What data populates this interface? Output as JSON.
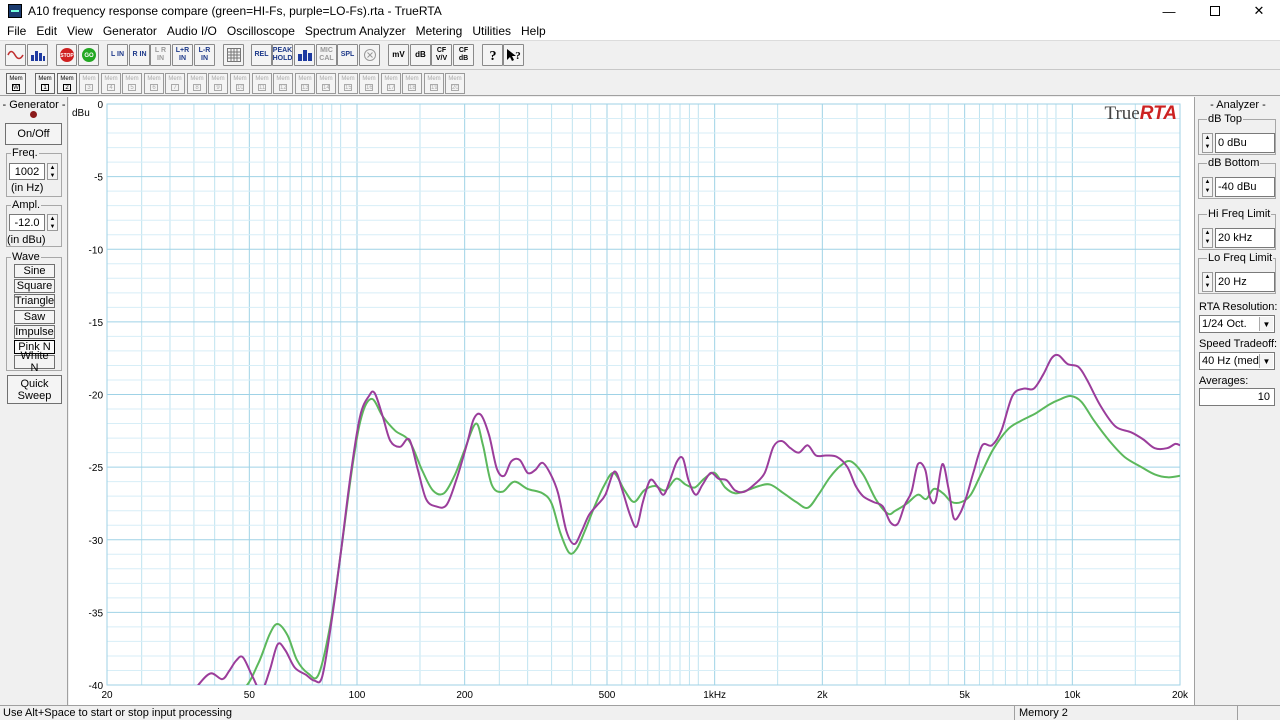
{
  "window": {
    "title": "A10 frequency response compare (green=HI-Fs, purple=LO-Fs).rta - TrueRTA",
    "minimize": "—",
    "close": "✕"
  },
  "menu": [
    "File",
    "Edit",
    "View",
    "Generator",
    "Audio I/O",
    "Oscilloscope",
    "Spectrum Analyzer",
    "Metering",
    "Utilities",
    "Help"
  ],
  "toolbar": {
    "stop_label": "STOP",
    "go_label": "GO",
    "l_in": "L IN",
    "r_in": "R IN",
    "lr_in_disabled": "L R IN",
    "lpr_in": "L+R IN",
    "lmr_in": "L-R IN",
    "rel": "REL",
    "peak_hold": "PEAK HOLD",
    "mic_cal": "MIC CAL",
    "spl": "SPL",
    "mv": "mV",
    "db": "dB",
    "cf_vv": "CF V/V",
    "cf_db": "CF dB"
  },
  "memory_buttons": [
    {
      "top": "Mem",
      "bottom": "W"
    },
    {
      "top": "Mem",
      "bottom": "1"
    },
    {
      "top": "Mem",
      "bottom": "2"
    },
    {
      "top": "Mem",
      "bottom": "3"
    },
    {
      "top": "Mem",
      "bottom": "4"
    },
    {
      "top": "Mem",
      "bottom": "5"
    },
    {
      "top": "Mem",
      "bottom": "6"
    },
    {
      "top": "Mem",
      "bottom": "7"
    },
    {
      "top": "Mem",
      "bottom": "8"
    },
    {
      "top": "Mem",
      "bottom": "9"
    },
    {
      "top": "Mem",
      "bottom": "10"
    },
    {
      "top": "Mem",
      "bottom": "11"
    },
    {
      "top": "Mem",
      "bottom": "12"
    },
    {
      "top": "Mem",
      "bottom": "13"
    },
    {
      "top": "Mem",
      "bottom": "14"
    },
    {
      "top": "Mem",
      "bottom": "15"
    },
    {
      "top": "Mem",
      "bottom": "16"
    },
    {
      "top": "Mem",
      "bottom": "17"
    },
    {
      "top": "Mem",
      "bottom": "18"
    },
    {
      "top": "Mem",
      "bottom": "19"
    },
    {
      "top": "Mem",
      "bottom": "20"
    },
    {
      "top": "Mem",
      "bottom": "21"
    }
  ],
  "generator": {
    "title": "- Generator -",
    "on_off": "On/Off",
    "freq_label": "Freq.",
    "freq_value": "1002",
    "freq_unit": "(in Hz)",
    "ampl_label": "Ampl.",
    "ampl_value": "-12.0",
    "ampl_unit": "(in dBu)",
    "wave_label": "Wave",
    "waves": [
      "Sine",
      "Square",
      "Triangle",
      "Saw",
      "Impulse",
      "Pink N",
      "White N"
    ],
    "quick_sweep": "Quick Sweep"
  },
  "analyzer": {
    "title": "- Analyzer -",
    "db_top_label": "dB Top",
    "db_top_value": "0 dBu",
    "db_bottom_label": "dB Bottom",
    "db_bottom_value": "-40 dBu",
    "hi_freq_label": "Hi Freq Limit",
    "hi_freq_value": "20 kHz",
    "lo_freq_label": "Lo Freq Limit",
    "lo_freq_value": "20 Hz",
    "resolution_label": "RTA Resolution:",
    "resolution_value": "1/24 Oct.",
    "speed_label": "Speed Tradeoff:",
    "speed_value": "40 Hz (med)",
    "averages_label": "Averages:",
    "averages_value": "10"
  },
  "status": {
    "hint": "Use Alt+Space to start or stop input processing",
    "memory": "Memory 2"
  },
  "colors": {
    "green_trace": "#5cb85c",
    "purple_trace": "#9b3d9b",
    "grid": "#bfe3f0",
    "logo_red": "#cc2222"
  },
  "chart_data": {
    "type": "line",
    "logo": "True",
    "logo_accent": "RTA",
    "ylabel": "dBu",
    "ylim": [
      -40,
      0
    ],
    "xlim": [
      20,
      20000
    ],
    "x_scale": "log",
    "y_ticks": [
      0,
      -5,
      -10,
      -15,
      -20,
      -25,
      -30,
      -35,
      -40
    ],
    "y_tick_labels": [
      "0",
      "-5",
      "-10",
      "-15",
      "-20",
      "-25",
      "-30",
      "-35",
      "-40"
    ],
    "x_ticks": [
      20,
      50,
      100,
      200,
      500,
      1000,
      2000,
      5000,
      10000,
      20000
    ],
    "x_tick_labels": [
      "20",
      "50",
      "100",
      "200",
      "500",
      "1kHz",
      "2k",
      "5k",
      "10k",
      "20k"
    ],
    "grid": true,
    "series": [
      {
        "color": "#5cb85c",
        "points": [
          [
            40,
            -41
          ],
          [
            48,
            -40.3
          ],
          [
            53,
            -38.5
          ],
          [
            57,
            -36.5
          ],
          [
            60,
            -35.8
          ],
          [
            64,
            -36.6
          ],
          [
            68,
            -38.3
          ],
          [
            73,
            -39.2
          ],
          [
            78,
            -39.3
          ],
          [
            84,
            -36
          ],
          [
            90,
            -31
          ],
          [
            97,
            -25
          ],
          [
            103,
            -21.5
          ],
          [
            110,
            -20.3
          ],
          [
            118,
            -21.5
          ],
          [
            128,
            -22.5
          ],
          [
            140,
            -23.2
          ],
          [
            152,
            -25.2
          ],
          [
            163,
            -26.6
          ],
          [
            175,
            -26.8
          ],
          [
            188,
            -25.5
          ],
          [
            200,
            -23.8
          ],
          [
            215,
            -22
          ],
          [
            225,
            -23.5
          ],
          [
            238,
            -26.2
          ],
          [
            255,
            -26.7
          ],
          [
            275,
            -26
          ],
          [
            300,
            -26.5
          ],
          [
            330,
            -26.8
          ],
          [
            350,
            -27.5
          ],
          [
            370,
            -29.5
          ],
          [
            392,
            -30.9
          ],
          [
            412,
            -30.6
          ],
          [
            435,
            -29.3
          ],
          [
            460,
            -27.8
          ],
          [
            490,
            -26.3
          ],
          [
            522,
            -25.4
          ],
          [
            560,
            -26.6
          ],
          [
            595,
            -27.4
          ],
          [
            635,
            -26.6
          ],
          [
            680,
            -26.3
          ],
          [
            728,
            -26.6
          ],
          [
            780,
            -25.8
          ],
          [
            830,
            -26.2
          ],
          [
            880,
            -26.4
          ],
          [
            935,
            -25.8
          ],
          [
            1000,
            -25.4
          ],
          [
            1070,
            -26.4
          ],
          [
            1140,
            -26.8
          ],
          [
            1230,
            -26.6
          ],
          [
            1330,
            -26.3
          ],
          [
            1430,
            -26.2
          ],
          [
            1560,
            -26.8
          ],
          [
            1690,
            -27.4
          ],
          [
            1820,
            -27.8
          ],
          [
            1950,
            -26.9
          ],
          [
            2100,
            -25.7
          ],
          [
            2250,
            -24.9
          ],
          [
            2400,
            -24.6
          ],
          [
            2600,
            -25.5
          ],
          [
            2820,
            -27.2
          ],
          [
            3050,
            -28.2
          ],
          [
            3200,
            -28
          ],
          [
            3450,
            -27.5
          ],
          [
            3700,
            -26.9
          ],
          [
            3900,
            -27.2
          ],
          [
            4100,
            -26.5
          ],
          [
            4350,
            -26.8
          ],
          [
            4600,
            -27.4
          ],
          [
            4900,
            -27.4
          ],
          [
            5200,
            -26.9
          ],
          [
            5550,
            -25.5
          ],
          [
            6000,
            -23.8
          ],
          [
            6600,
            -22.4
          ],
          [
            7200,
            -21.8
          ],
          [
            7900,
            -21.3
          ],
          [
            8600,
            -20.7
          ],
          [
            9300,
            -20.3
          ],
          [
            9900,
            -20.1
          ],
          [
            10600,
            -20.5
          ],
          [
            11500,
            -21.8
          ],
          [
            12700,
            -23.2
          ],
          [
            14000,
            -24.3
          ],
          [
            15600,
            -25
          ],
          [
            17000,
            -25.5
          ],
          [
            18500,
            -25.7
          ],
          [
            20000,
            -25.6
          ]
        ]
      },
      {
        "color": "#9b3d9b",
        "points": [
          [
            34,
            -41
          ],
          [
            36,
            -40
          ],
          [
            39,
            -39.2
          ],
          [
            42,
            -39.6
          ],
          [
            44,
            -39
          ],
          [
            46,
            -38.3
          ],
          [
            48,
            -38.1
          ],
          [
            51,
            -39.4
          ],
          [
            54,
            -40.4
          ],
          [
            57,
            -39
          ],
          [
            60,
            -37.2
          ],
          [
            63,
            -37.6
          ],
          [
            67,
            -38.8
          ],
          [
            72,
            -39.3
          ],
          [
            76,
            -39.7
          ],
          [
            80,
            -39.4
          ],
          [
            85,
            -35.5
          ],
          [
            90,
            -31
          ],
          [
            96,
            -25.5
          ],
          [
            102,
            -21.5
          ],
          [
            108,
            -20.1
          ],
          [
            112,
            -19.9
          ],
          [
            118,
            -21.5
          ],
          [
            124,
            -23.2
          ],
          [
            132,
            -23.6
          ],
          [
            140,
            -23.1
          ],
          [
            148,
            -25.2
          ],
          [
            156,
            -27.2
          ],
          [
            166,
            -27.7
          ],
          [
            178,
            -27.6
          ],
          [
            190,
            -25.8
          ],
          [
            203,
            -23.4
          ],
          [
            212,
            -21.7
          ],
          [
            222,
            -21.4
          ],
          [
            234,
            -22.8
          ],
          [
            246,
            -25.1
          ],
          [
            258,
            -25.6
          ],
          [
            270,
            -24.6
          ],
          [
            285,
            -24.5
          ],
          [
            300,
            -25.4
          ],
          [
            315,
            -25.2
          ],
          [
            330,
            -24.7
          ],
          [
            348,
            -25.5
          ],
          [
            365,
            -26.8
          ],
          [
            385,
            -29.4
          ],
          [
            405,
            -30.3
          ],
          [
            425,
            -29.4
          ],
          [
            445,
            -28.3
          ],
          [
            470,
            -27.6
          ],
          [
            495,
            -26.9
          ],
          [
            525,
            -25.3
          ],
          [
            552,
            -26.6
          ],
          [
            580,
            -28.3
          ],
          [
            605,
            -29.1
          ],
          [
            630,
            -27.4
          ],
          [
            660,
            -25.9
          ],
          [
            690,
            -26.3
          ],
          [
            720,
            -26.9
          ],
          [
            750,
            -25.9
          ],
          [
            785,
            -24.6
          ],
          [
            815,
            -24.4
          ],
          [
            845,
            -25.9
          ],
          [
            885,
            -26.9
          ],
          [
            925,
            -26.2
          ],
          [
            975,
            -25.4
          ],
          [
            1025,
            -25.8
          ],
          [
            1080,
            -25.9
          ],
          [
            1140,
            -26.6
          ],
          [
            1210,
            -26.7
          ],
          [
            1290,
            -26.2
          ],
          [
            1380,
            -25.4
          ],
          [
            1460,
            -23.6
          ],
          [
            1540,
            -23.2
          ],
          [
            1630,
            -23.7
          ],
          [
            1720,
            -24
          ],
          [
            1820,
            -23.5
          ],
          [
            1920,
            -24.2
          ],
          [
            2050,
            -24.2
          ],
          [
            2200,
            -24.3
          ],
          [
            2350,
            -25
          ],
          [
            2480,
            -26.3
          ],
          [
            2600,
            -27
          ],
          [
            2780,
            -27.4
          ],
          [
            2950,
            -27.7
          ],
          [
            3100,
            -28.8
          ],
          [
            3250,
            -28.9
          ],
          [
            3400,
            -27.6
          ],
          [
            3550,
            -26.7
          ],
          [
            3700,
            -24.8
          ],
          [
            3880,
            -25.2
          ],
          [
            4000,
            -27.1
          ],
          [
            4150,
            -27.3
          ],
          [
            4330,
            -24.8
          ],
          [
            4500,
            -26.4
          ],
          [
            4660,
            -28.5
          ],
          [
            4850,
            -28.2
          ],
          [
            5050,
            -27.1
          ],
          [
            5300,
            -25.3
          ],
          [
            5600,
            -23.5
          ],
          [
            5960,
            -23.5
          ],
          [
            6330,
            -22.5
          ],
          [
            6800,
            -20.1
          ],
          [
            7300,
            -19.6
          ],
          [
            7800,
            -19.6
          ],
          [
            8300,
            -18.6
          ],
          [
            8750,
            -17.5
          ],
          [
            9150,
            -17.3
          ],
          [
            9700,
            -17.9
          ],
          [
            10400,
            -18.1
          ],
          [
            11000,
            -19
          ],
          [
            12000,
            -20.8
          ],
          [
            13200,
            -22.2
          ],
          [
            14600,
            -22.6
          ],
          [
            15800,
            -23.1
          ],
          [
            17000,
            -23.7
          ],
          [
            18400,
            -23.7
          ],
          [
            19400,
            -23.4
          ],
          [
            20000,
            -23.5
          ]
        ]
      }
    ]
  }
}
